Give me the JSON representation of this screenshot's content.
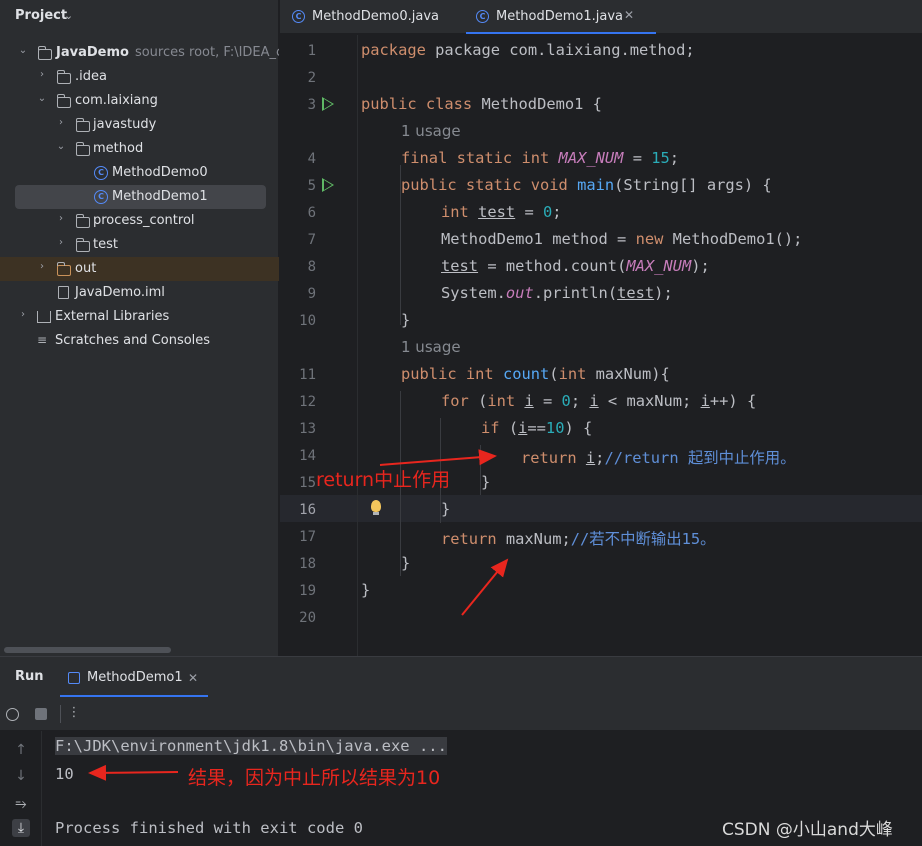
{
  "project": {
    "title": "Project",
    "tree": [
      {
        "label": "JavaDemo",
        "hint": "sources root,  F:\\IDEA_co",
        "bold": true
      },
      {
        "label": ".idea"
      },
      {
        "label": "com.laixiang"
      },
      {
        "label": "javastudy"
      },
      {
        "label": "method"
      },
      {
        "label": "MethodDemo0"
      },
      {
        "label": "MethodDemo1"
      },
      {
        "label": "process_control"
      },
      {
        "label": "test"
      },
      {
        "label": "out"
      },
      {
        "label": "JavaDemo.iml"
      },
      {
        "label": "External Libraries"
      },
      {
        "label": "Scratches and Consoles"
      }
    ]
  },
  "tabs": [
    {
      "label": "MethodDemo0.java"
    },
    {
      "label": "MethodDemo1.java",
      "active": true
    }
  ],
  "editor": {
    "line_numbers": [
      "1",
      "2",
      "3",
      "4",
      "5",
      "6",
      "7",
      "8",
      "9",
      "10",
      "11",
      "12",
      "13",
      "14",
      "15",
      "16",
      "17",
      "18",
      "19",
      "20"
    ],
    "usage_hint": "1 usage",
    "current_line": 16,
    "lines": {
      "l1": "package com.laixiang.method;",
      "l3_kw": "public class",
      "l3_rest": " MethodDemo1 {",
      "l4_kw": "final static int",
      "l4_fld": "MAX_NUM",
      "l4_eq": " = ",
      "l4_num": "15",
      "l4_end": ";",
      "l5_kw": "public static void",
      "l5_fn": "main",
      "l5_rest": "(String[] args) {",
      "l6_kw": "int",
      "l6_var": "test",
      "l6_eq": " = ",
      "l6_num": "0",
      "l6_end": ";",
      "l7_a": "MethodDemo1 method = ",
      "l7_kw": "new",
      "l7_b": " MethodDemo1();",
      "l8_var": "test",
      "l8_a": " = method.count(",
      "l8_fld": "MAX_NUM",
      "l8_b": ");",
      "l9_a": "System.",
      "l9_out": "out",
      "l9_b": ".println(",
      "l9_var": "test",
      "l9_c": ");",
      "l10": "}",
      "l11_kw": "public int",
      "l11_fn": "count",
      "l11_a": "(",
      "l11_kw2": "int",
      "l11_b": " maxNum){",
      "l12_kw": "for",
      "l12_a": " (",
      "l12_kw2": "int",
      "l12_i1": "i",
      "l12_b": " = ",
      "l12_num": "0",
      "l12_c": "; ",
      "l12_i2": "i",
      "l12_d": " < maxNum; ",
      "l12_i3": "i",
      "l12_e": "++) {",
      "l13_kw": "if",
      "l13_a": " (",
      "l13_i": "i",
      "l13_b": "==",
      "l13_num": "10",
      "l13_c": ") {",
      "l14_kw": "return",
      "l14_i": "i",
      "l14_a": ";",
      "l14_cm": "//return 起到中止作用。",
      "l15": "}",
      "l16": "}",
      "l17_kw": "return",
      "l17_a": " maxNum;",
      "l17_cm": "//若不中断输出15。",
      "l18": "}",
      "l19": "}"
    }
  },
  "run": {
    "title": "Run",
    "tab_label": "MethodDemo1",
    "command": "F:\\JDK\\environment\\jdk1.8\\bin\\java.exe ...",
    "output_value": "10",
    "exit_message": "Process finished with exit code 0"
  },
  "annotations": {
    "return_note": "return中止作用",
    "result_note": "结果，因为中止所以结果为10",
    "arrow_color": "#e8261e"
  },
  "watermark": "CSDN @小山and大峰",
  "colors": {
    "keyword": "#cf8e6d",
    "number": "#2aacb8",
    "field": "#c77dbb",
    "function": "#56a8f5",
    "comment": "#5f8fd8",
    "accent": "#3574f0"
  }
}
